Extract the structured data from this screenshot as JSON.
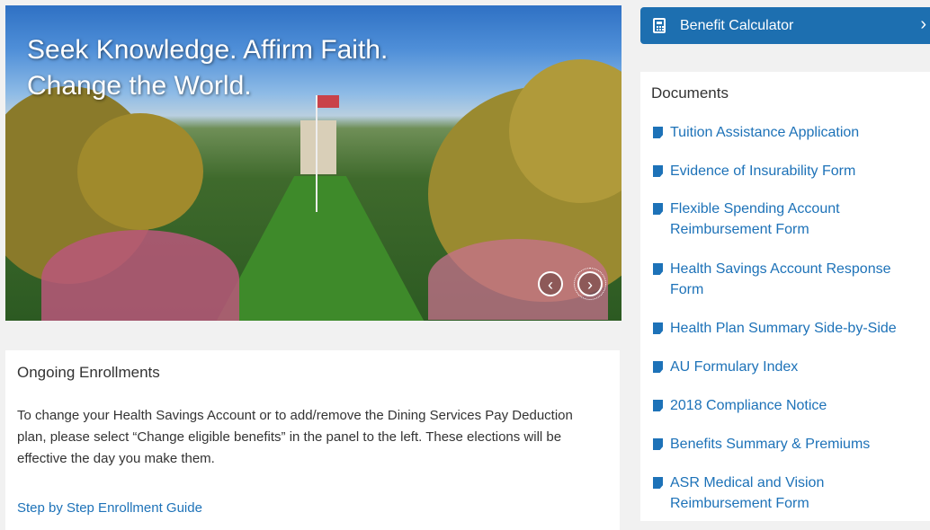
{
  "hero": {
    "headline": "Seek Knowledge. Affirm Faith. Change the World."
  },
  "carousel": {
    "prev_icon": "chevron-left-icon",
    "next_icon": "chevron-right-icon"
  },
  "enrollment": {
    "title": "Ongoing Enrollments",
    "body": "To change your Health Savings Account or to add/remove the Dining Services Pay Deduction plan, please select “Change eligible benefits” in the panel to the left. These elections will be effective the day you make them.",
    "guide_link": "Step by Step Enrollment Guide"
  },
  "calculator": {
    "label": "Benefit Calculator",
    "icon": "calculator-icon"
  },
  "documents": {
    "title": "Documents",
    "items": [
      {
        "label": "Tuition Assistance Application"
      },
      {
        "label": "Evidence of Insurability Form"
      },
      {
        "label": "Flexible Spending Account Reimbursement Form"
      },
      {
        "label": "Health Savings Account Response Form"
      },
      {
        "label": "Health Plan Summary Side-by-Side"
      },
      {
        "label": "AU Formulary Index"
      },
      {
        "label": "2018 Compliance Notice"
      },
      {
        "label": "Benefits Summary & Premiums"
      },
      {
        "label": "ASR Medical and Vision Reimbursement Form"
      }
    ]
  },
  "colors": {
    "accent": "#1d6fb0",
    "link": "#1d72b8",
    "background": "#f1f1f1"
  }
}
